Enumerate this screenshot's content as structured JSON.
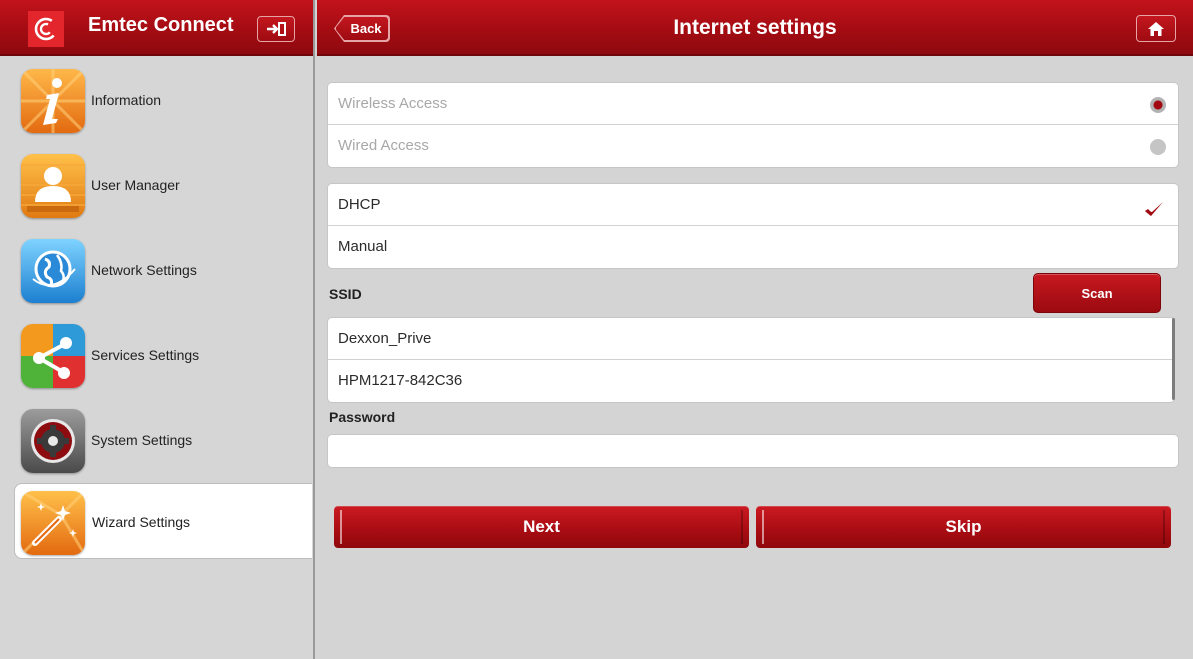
{
  "app": {
    "title": "Emtec Connect"
  },
  "sidebar": {
    "items": [
      {
        "label": "Information",
        "icon": "information-icon",
        "active": false
      },
      {
        "label": "User Manager",
        "icon": "user-manager-icon",
        "active": false
      },
      {
        "label": "Network Settings",
        "icon": "globe-icon",
        "active": false
      },
      {
        "label": "Services Settings",
        "icon": "share-icon",
        "active": false
      },
      {
        "label": "System Settings",
        "icon": "gear-icon",
        "active": false
      },
      {
        "label": "Wizard Settings",
        "icon": "magic-wand-icon",
        "active": true
      }
    ]
  },
  "topbar": {
    "back_label": "Back",
    "title": "Internet settings",
    "home_icon": "home-icon"
  },
  "access": {
    "options": [
      {
        "label": "Wireless Access",
        "selected": true
      },
      {
        "label": "Wired Access",
        "selected": false
      }
    ]
  },
  "ip_mode": {
    "options": [
      {
        "label": "DHCP",
        "checked": true
      },
      {
        "label": "Manual",
        "checked": false
      }
    ]
  },
  "ssid": {
    "label": "SSID",
    "scan_label": "Scan",
    "networks": [
      "Dexxon_Prive",
      "HPM1217-842C36"
    ]
  },
  "password": {
    "label": "Password",
    "value": ""
  },
  "actions": {
    "next_label": "Next",
    "skip_label": "Skip"
  },
  "colors": {
    "accent_red": "#a40c12",
    "sidebar_bg": "#d6d6d6",
    "content_bg": "#d4d4d4"
  }
}
